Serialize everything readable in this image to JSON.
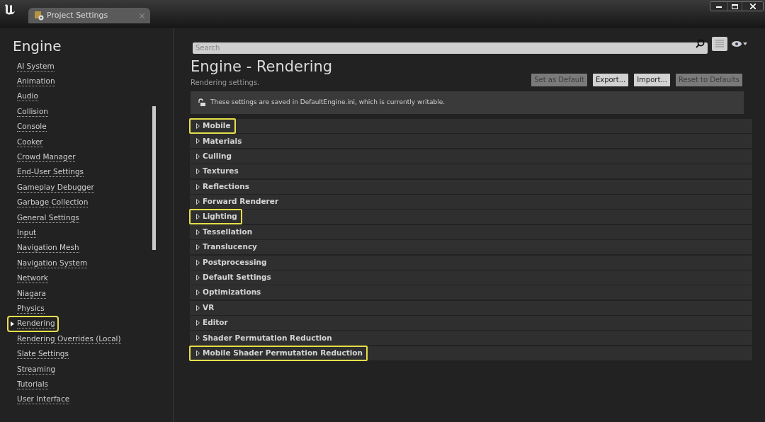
{
  "window": {
    "tab_title": "Project Settings"
  },
  "sidebar": {
    "heading": "Engine",
    "items": [
      {
        "label": "AI System",
        "selected": false,
        "highlighted": false
      },
      {
        "label": "Animation",
        "selected": false,
        "highlighted": false
      },
      {
        "label": "Audio",
        "selected": false,
        "highlighted": false
      },
      {
        "label": "Collision",
        "selected": false,
        "highlighted": false
      },
      {
        "label": "Console",
        "selected": false,
        "highlighted": false
      },
      {
        "label": "Cooker",
        "selected": false,
        "highlighted": false
      },
      {
        "label": "Crowd Manager",
        "selected": false,
        "highlighted": false
      },
      {
        "label": "End-User Settings",
        "selected": false,
        "highlighted": false
      },
      {
        "label": "Gameplay Debugger",
        "selected": false,
        "highlighted": false
      },
      {
        "label": "Garbage Collection",
        "selected": false,
        "highlighted": false
      },
      {
        "label": "General Settings",
        "selected": false,
        "highlighted": false
      },
      {
        "label": "Input",
        "selected": false,
        "highlighted": false
      },
      {
        "label": "Navigation Mesh",
        "selected": false,
        "highlighted": false
      },
      {
        "label": "Navigation System",
        "selected": false,
        "highlighted": false
      },
      {
        "label": "Network",
        "selected": false,
        "highlighted": false
      },
      {
        "label": "Niagara",
        "selected": false,
        "highlighted": false
      },
      {
        "label": "Physics",
        "selected": false,
        "highlighted": false
      },
      {
        "label": "Rendering",
        "selected": true,
        "highlighted": true
      },
      {
        "label": "Rendering Overrides (Local)",
        "selected": false,
        "highlighted": false
      },
      {
        "label": "Slate Settings",
        "selected": false,
        "highlighted": false
      },
      {
        "label": "Streaming",
        "selected": false,
        "highlighted": false
      },
      {
        "label": "Tutorials",
        "selected": false,
        "highlighted": false
      },
      {
        "label": "User Interface",
        "selected": false,
        "highlighted": false
      }
    ]
  },
  "search": {
    "placeholder": "Search"
  },
  "page": {
    "title": "Engine - Rendering",
    "subtitle": "Rendering settings.",
    "buttons": [
      {
        "label": "Set as Default",
        "disabled": true
      },
      {
        "label": "Export...",
        "disabled": false
      },
      {
        "label": "Import...",
        "disabled": false
      },
      {
        "label": "Reset to Defaults",
        "disabled": true
      }
    ],
    "notice": "These settings are saved in DefaultEngine.ini, which is currently writable."
  },
  "sections": [
    {
      "label": "Mobile",
      "highlighted": true
    },
    {
      "label": "Materials",
      "highlighted": false
    },
    {
      "label": "Culling",
      "highlighted": false
    },
    {
      "label": "Textures",
      "highlighted": false
    },
    {
      "label": "Reflections",
      "highlighted": false
    },
    {
      "label": "Forward Renderer",
      "highlighted": false
    },
    {
      "label": "Lighting",
      "highlighted": true
    },
    {
      "label": "Tessellation",
      "highlighted": false
    },
    {
      "label": "Translucency",
      "highlighted": false
    },
    {
      "label": "Postprocessing",
      "highlighted": false
    },
    {
      "label": "Default Settings",
      "highlighted": false
    },
    {
      "label": "Optimizations",
      "highlighted": false
    },
    {
      "label": "VR",
      "highlighted": false
    },
    {
      "label": "Editor",
      "highlighted": false
    },
    {
      "label": "Shader Permutation Reduction",
      "highlighted": false
    },
    {
      "label": "Mobile Shader Permutation Reduction",
      "highlighted": true
    }
  ]
}
